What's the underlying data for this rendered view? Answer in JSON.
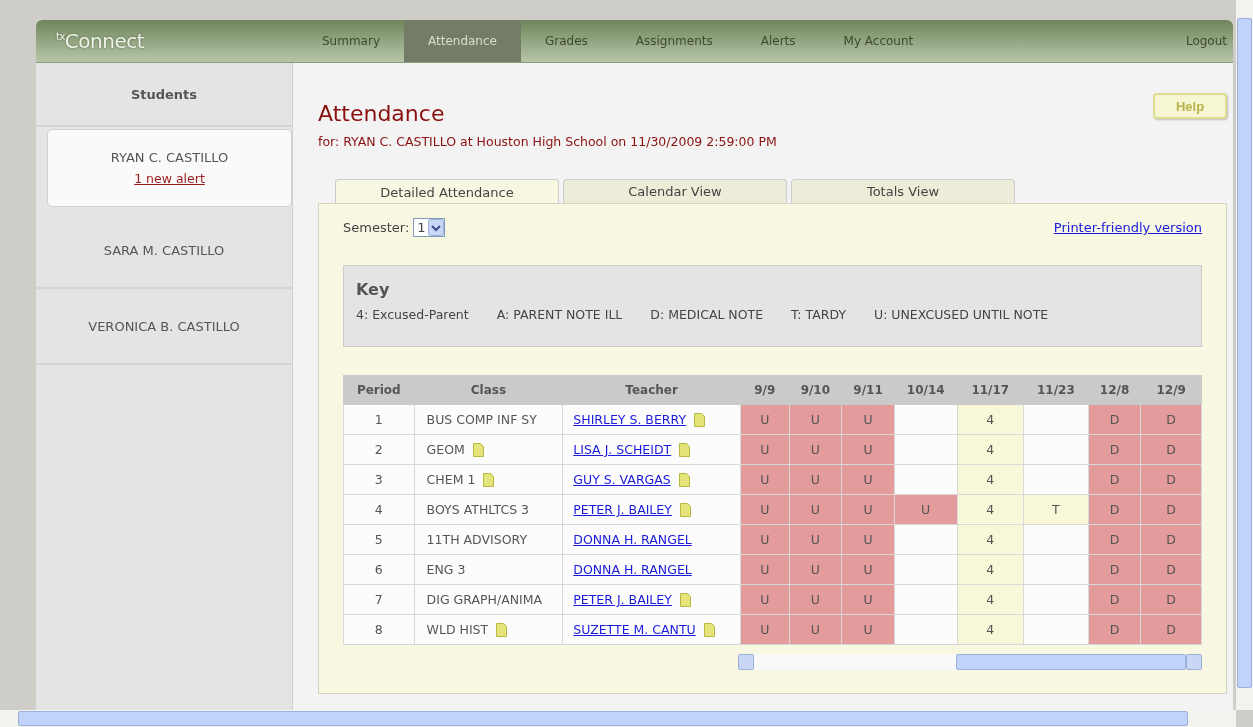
{
  "header": {
    "logo_prefix": "tx",
    "logo": "Connect",
    "nav": [
      {
        "label": "Summary",
        "selected": false
      },
      {
        "label": "Attendance",
        "selected": true
      },
      {
        "label": "Grades",
        "selected": false
      },
      {
        "label": "Assignments",
        "selected": false
      },
      {
        "label": "Alerts",
        "selected": false
      },
      {
        "label": "My Account",
        "selected": false
      }
    ],
    "logout": "Logout"
  },
  "sidebar": {
    "title": "Students",
    "students": [
      {
        "name": "RYAN C. CASTILLO",
        "alert": "1 new alert",
        "selected": true
      },
      {
        "name": "SARA M. CASTILLO",
        "selected": false
      },
      {
        "name": "VERONICA B. CASTILLO",
        "selected": false
      }
    ]
  },
  "page": {
    "title": "Attendance",
    "subtitle": "for: RYAN C. CASTILLO at Houston High School on 11/30/2009 2:59:00 PM",
    "help": "Help"
  },
  "tabs": [
    {
      "label": "Detailed Attendance",
      "selected": true
    },
    {
      "label": "Calendar View",
      "selected": false
    },
    {
      "label": "Totals View",
      "selected": false
    }
  ],
  "semester": {
    "label": "Semester:",
    "value": "1"
  },
  "printer_link": "Printer-friendly version",
  "key": {
    "title": "Key",
    "items": [
      "4: Excused-Parent",
      "A: PARENT NOTE ILL",
      "D: MEDICAL NOTE",
      "T: TARDY",
      "U: UNEXCUSED UNTIL NOTE"
    ]
  },
  "table": {
    "columns": [
      "Period",
      "Class",
      "Teacher",
      "9/9",
      "9/10",
      "9/11",
      "10/14",
      "11/17",
      "11/23",
      "12/8",
      "12/9"
    ],
    "rows": [
      {
        "cells": [
          {
            "kind": "period",
            "text": "1"
          },
          {
            "kind": "class",
            "text": "BUS COMP INF SY",
            "note": false
          },
          {
            "kind": "teacher",
            "text": "SHIRLEY S. BERRY",
            "note": true
          },
          {
            "kind": "mark",
            "text": "U",
            "color": "#e39b9b"
          },
          {
            "kind": "mark",
            "text": "U",
            "color": "#e39b9b"
          },
          {
            "kind": "mark",
            "text": "U",
            "color": "#e39b9b"
          },
          {
            "kind": "mark",
            "color": "#fcfcfc"
          },
          {
            "kind": "mark",
            "text": "4",
            "color": "#f8f8d8"
          },
          {
            "kind": "mark",
            "color": "#fcfcfc"
          },
          {
            "kind": "mark",
            "text": "D",
            "color": "#e39b9b"
          },
          {
            "kind": "mark",
            "text": "D",
            "color": "#e39b9b"
          }
        ]
      },
      {
        "cells": [
          {
            "kind": "period",
            "text": "2"
          },
          {
            "kind": "class",
            "text": "GEOM",
            "note": true
          },
          {
            "kind": "teacher",
            "text": "LISA J. SCHEIDT",
            "note": true
          },
          {
            "kind": "mark",
            "text": "U",
            "color": "#e39b9b"
          },
          {
            "kind": "mark",
            "text": "U",
            "color": "#e39b9b"
          },
          {
            "kind": "mark",
            "text": "U",
            "color": "#e39b9b"
          },
          {
            "kind": "mark",
            "color": "#fcfcfc"
          },
          {
            "kind": "mark",
            "text": "4",
            "color": "#f8f8d8"
          },
          {
            "kind": "mark",
            "color": "#fcfcfc"
          },
          {
            "kind": "mark",
            "text": "D",
            "color": "#e39b9b"
          },
          {
            "kind": "mark",
            "text": "D",
            "color": "#e39b9b"
          }
        ]
      },
      {
        "cells": [
          {
            "kind": "period",
            "text": "3"
          },
          {
            "kind": "class",
            "text": "CHEM 1",
            "note": true
          },
          {
            "kind": "teacher",
            "text": "GUY S. VARGAS",
            "note": true
          },
          {
            "kind": "mark",
            "text": "U",
            "color": "#e39b9b"
          },
          {
            "kind": "mark",
            "text": "U",
            "color": "#e39b9b"
          },
          {
            "kind": "mark",
            "text": "U",
            "color": "#e39b9b"
          },
          {
            "kind": "mark",
            "color": "#fcfcfc"
          },
          {
            "kind": "mark",
            "text": "4",
            "color": "#f8f8d8"
          },
          {
            "kind": "mark",
            "color": "#fcfcfc"
          },
          {
            "kind": "mark",
            "text": "D",
            "color": "#e39b9b"
          },
          {
            "kind": "mark",
            "text": "D",
            "color": "#e39b9b"
          }
        ]
      },
      {
        "cells": [
          {
            "kind": "period",
            "text": "4"
          },
          {
            "kind": "class",
            "text": "BOYS ATHLTCS 3",
            "note": false
          },
          {
            "kind": "teacher",
            "text": "PETER J. BAILEY",
            "note": true
          },
          {
            "kind": "mark",
            "text": "U",
            "color": "#e39b9b"
          },
          {
            "kind": "mark",
            "text": "U",
            "color": "#e39b9b"
          },
          {
            "kind": "mark",
            "text": "U",
            "color": "#e39b9b"
          },
          {
            "kind": "mark",
            "text": "U",
            "color": "#e39b9b"
          },
          {
            "kind": "mark",
            "text": "4",
            "color": "#f8f8d8"
          },
          {
            "kind": "mark",
            "text": "T",
            "color": "#f8f8d8"
          },
          {
            "kind": "mark",
            "text": "D",
            "color": "#e39b9b"
          },
          {
            "kind": "mark",
            "text": "D",
            "color": "#e39b9b"
          }
        ]
      },
      {
        "cells": [
          {
            "kind": "period",
            "text": "5"
          },
          {
            "kind": "class",
            "text": "11TH ADVISORY",
            "note": false
          },
          {
            "kind": "teacher",
            "text": "DONNA H. RANGEL",
            "note": false
          },
          {
            "kind": "mark",
            "text": "U",
            "color": "#e39b9b"
          },
          {
            "kind": "mark",
            "text": "U",
            "color": "#e39b9b"
          },
          {
            "kind": "mark",
            "text": "U",
            "color": "#e39b9b"
          },
          {
            "kind": "mark",
            "color": "#fcfcfc"
          },
          {
            "kind": "mark",
            "text": "4",
            "color": "#f8f8d8"
          },
          {
            "kind": "mark",
            "color": "#fcfcfc"
          },
          {
            "kind": "mark",
            "text": "D",
            "color": "#e39b9b"
          },
          {
            "kind": "mark",
            "text": "D",
            "color": "#e39b9b"
          }
        ]
      },
      {
        "cells": [
          {
            "kind": "period",
            "text": "6"
          },
          {
            "kind": "class",
            "text": "ENG 3",
            "note": false
          },
          {
            "kind": "teacher",
            "text": "DONNA H. RANGEL",
            "note": false
          },
          {
            "kind": "mark",
            "text": "U",
            "color": "#e39b9b"
          },
          {
            "kind": "mark",
            "text": "U",
            "color": "#e39b9b"
          },
          {
            "kind": "mark",
            "text": "U",
            "color": "#e39b9b"
          },
          {
            "kind": "mark",
            "color": "#fcfcfc"
          },
          {
            "kind": "mark",
            "text": "4",
            "color": "#f8f8d8"
          },
          {
            "kind": "mark",
            "color": "#fcfcfc"
          },
          {
            "kind": "mark",
            "text": "D",
            "color": "#e39b9b"
          },
          {
            "kind": "mark",
            "text": "D",
            "color": "#e39b9b"
          }
        ]
      },
      {
        "cells": [
          {
            "kind": "period",
            "text": "7"
          },
          {
            "kind": "class",
            "text": "DIG GRAPH/ANIMA",
            "note": false
          },
          {
            "kind": "teacher",
            "text": "PETER J. BAILEY",
            "note": true
          },
          {
            "kind": "mark",
            "text": "U",
            "color": "#e39b9b"
          },
          {
            "kind": "mark",
            "text": "U",
            "color": "#e39b9b"
          },
          {
            "kind": "mark",
            "text": "U",
            "color": "#e39b9b"
          },
          {
            "kind": "mark",
            "color": "#fcfcfc"
          },
          {
            "kind": "mark",
            "text": "4",
            "color": "#f8f8d8"
          },
          {
            "kind": "mark",
            "color": "#fcfcfc"
          },
          {
            "kind": "mark",
            "text": "D",
            "color": "#e39b9b"
          },
          {
            "kind": "mark",
            "text": "D",
            "color": "#e39b9b"
          }
        ]
      },
      {
        "cells": [
          {
            "kind": "period",
            "text": "8"
          },
          {
            "kind": "class",
            "text": "WLD HIST",
            "note": true
          },
          {
            "kind": "teacher",
            "text": "SUZETTE M. CANTU",
            "note": true
          },
          {
            "kind": "mark",
            "text": "U",
            "color": "#e39b9b"
          },
          {
            "kind": "mark",
            "text": "U",
            "color": "#e39b9b"
          },
          {
            "kind": "mark",
            "text": "U",
            "color": "#e39b9b"
          },
          {
            "kind": "mark",
            "color": "#fcfcfc"
          },
          {
            "kind": "mark",
            "text": "4",
            "color": "#f8f8d8"
          },
          {
            "kind": "mark",
            "color": "#fcfcfc"
          },
          {
            "kind": "mark",
            "text": "D",
            "color": "#e39b9b"
          },
          {
            "kind": "mark",
            "text": "D",
            "color": "#e39b9b"
          }
        ]
      }
    ]
  }
}
